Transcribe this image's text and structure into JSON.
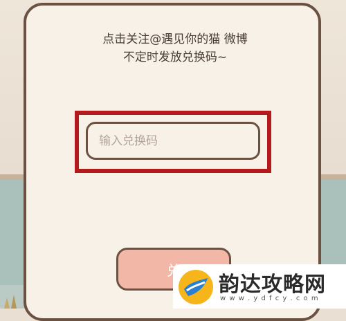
{
  "dialog": {
    "notice_line1": "点击关注@遇见你的猫 微博",
    "notice_line2": "不定时发放兑换码~"
  },
  "redeem": {
    "input_value": "",
    "input_placeholder": "输入兑换码",
    "button_label": "兑",
    "highlight_color": "#b4191c"
  },
  "watermark": {
    "title": "韵达攻略网",
    "url": "w w w . y d f c y . c o m"
  },
  "colors": {
    "dialog_bg": "#f7f1e8",
    "border": "#6b5142",
    "button_bg": "#f3b7a8"
  }
}
